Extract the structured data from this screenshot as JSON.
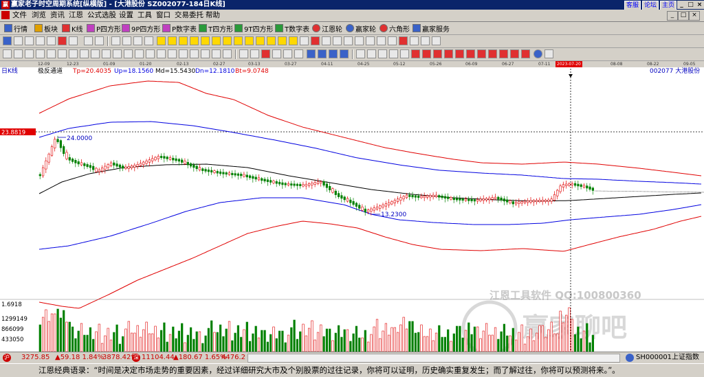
{
  "window": {
    "logo": "赢",
    "title": "赢家老子时空周期系统[纵横版] - [大港股份  SZ002077-184日K线]",
    "links": [
      "客服",
      "论坛",
      "主页"
    ],
    "buttons": [
      "_",
      "□",
      "×"
    ]
  },
  "menu": {
    "items": [
      "文件",
      "浏览",
      "资讯",
      "江恩",
      "公式选股",
      "设置",
      "工具",
      "窗口",
      "交易委托",
      "帮助"
    ],
    "mdi_buttons": [
      "_",
      "□",
      "×"
    ]
  },
  "toolbar1": {
    "items": [
      "行情",
      "板块",
      "K线",
      "P四方形",
      "9P四方形",
      "P数字表",
      "T四方形",
      "9T四方形",
      "T数字表",
      "江恩轮",
      "赢家轮",
      "六角形",
      "赢家服务"
    ]
  },
  "dates": {
    "labels": [
      "12-09",
      "12-23",
      "01-09",
      "01-20",
      "02-13",
      "02-27",
      "03-13",
      "03-27",
      "04-11",
      "04-25",
      "05-12",
      "05-26",
      "06-09",
      "06-27",
      "07-11",
      "08-08",
      "08-22",
      "09-05"
    ],
    "current": "2023-07-20"
  },
  "chart": {
    "period_label": "日K线",
    "indicator_name": "极反通道",
    "tp": "Tp=20.4035",
    "up": "Up=18.1560",
    "md": "Md=15.5430",
    "dn": "Dn=12.1810",
    "bt": "Bt=9.0748",
    "stock_label": "002077  大港股份",
    "price_marker": "23.8819",
    "high_note": "24.0000",
    "low_note": "13.2300",
    "vol_max": "1.6918",
    "vol_ticks": [
      "1299149",
      "866099",
      "433050"
    ],
    "watermark1": "江恩工具软件  QQ:100800360",
    "watermark2": "赢家聊吧",
    "colors": {
      "red_band": "#e00000",
      "blue_band": "#0000e0",
      "mid_line": "#000000",
      "up_candle": "#e00000",
      "down_candle": "#008000"
    }
  },
  "status": {
    "sh_value": "3275.85",
    "sh_change": "▲59.18 1.84%",
    "sh_amount": "3878.42亿",
    "sz_value": "11104.44",
    "sz_change": "▲180.67 1.65%",
    "sz_amount": "4476.2",
    "index_label": "SH000001上证指数"
  },
  "quote": {
    "text": "江恩经典语录：“时间是决定市场走势的重要因素，经过详细研究大市及个别股票的过往记录，你将可以证明，历史确实重复发生；而了解过往，你将可以预测将来。”。"
  }
}
